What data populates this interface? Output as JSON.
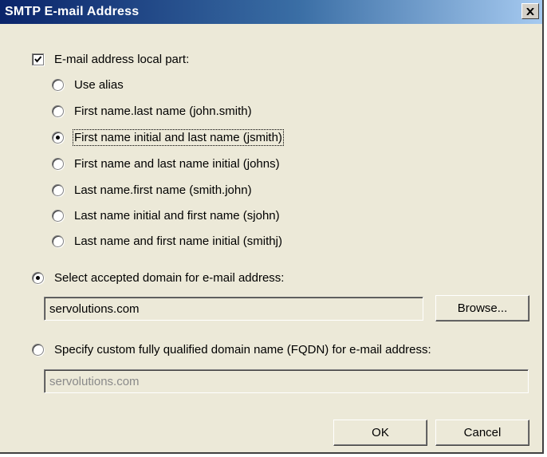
{
  "dialog": {
    "title": "SMTP E-mail Address",
    "close_icon": "close-icon"
  },
  "local_part": {
    "checkbox_label": "E-mail address local part:",
    "checked": true,
    "options": [
      {
        "label": "Use alias",
        "selected": false
      },
      {
        "label": "First name.last name (john.smith)",
        "selected": false
      },
      {
        "label": "First name initial and last name (jsmith)",
        "selected": true
      },
      {
        "label": "First name and last name initial (johns)",
        "selected": false
      },
      {
        "label": "Last name.first name (smith.john)",
        "selected": false
      },
      {
        "label": "Last name initial and first name (sjohn)",
        "selected": false
      },
      {
        "label": "Last name and first name initial (smithj)",
        "selected": false
      }
    ]
  },
  "accepted_domain": {
    "label": "Select accepted domain for e-mail address:",
    "selected": true,
    "value": "servolutions.com",
    "browse_label": "Browse..."
  },
  "custom_domain": {
    "label": "Specify custom fully qualified domain name (FQDN) for e-mail address:",
    "selected": false,
    "value": "servolutions.com"
  },
  "buttons": {
    "ok": "OK",
    "cancel": "Cancel"
  },
  "colors": {
    "title_gradient_start": "#0a246a",
    "title_gradient_end": "#a6caf0",
    "dialog_bg": "#ece9d8"
  }
}
